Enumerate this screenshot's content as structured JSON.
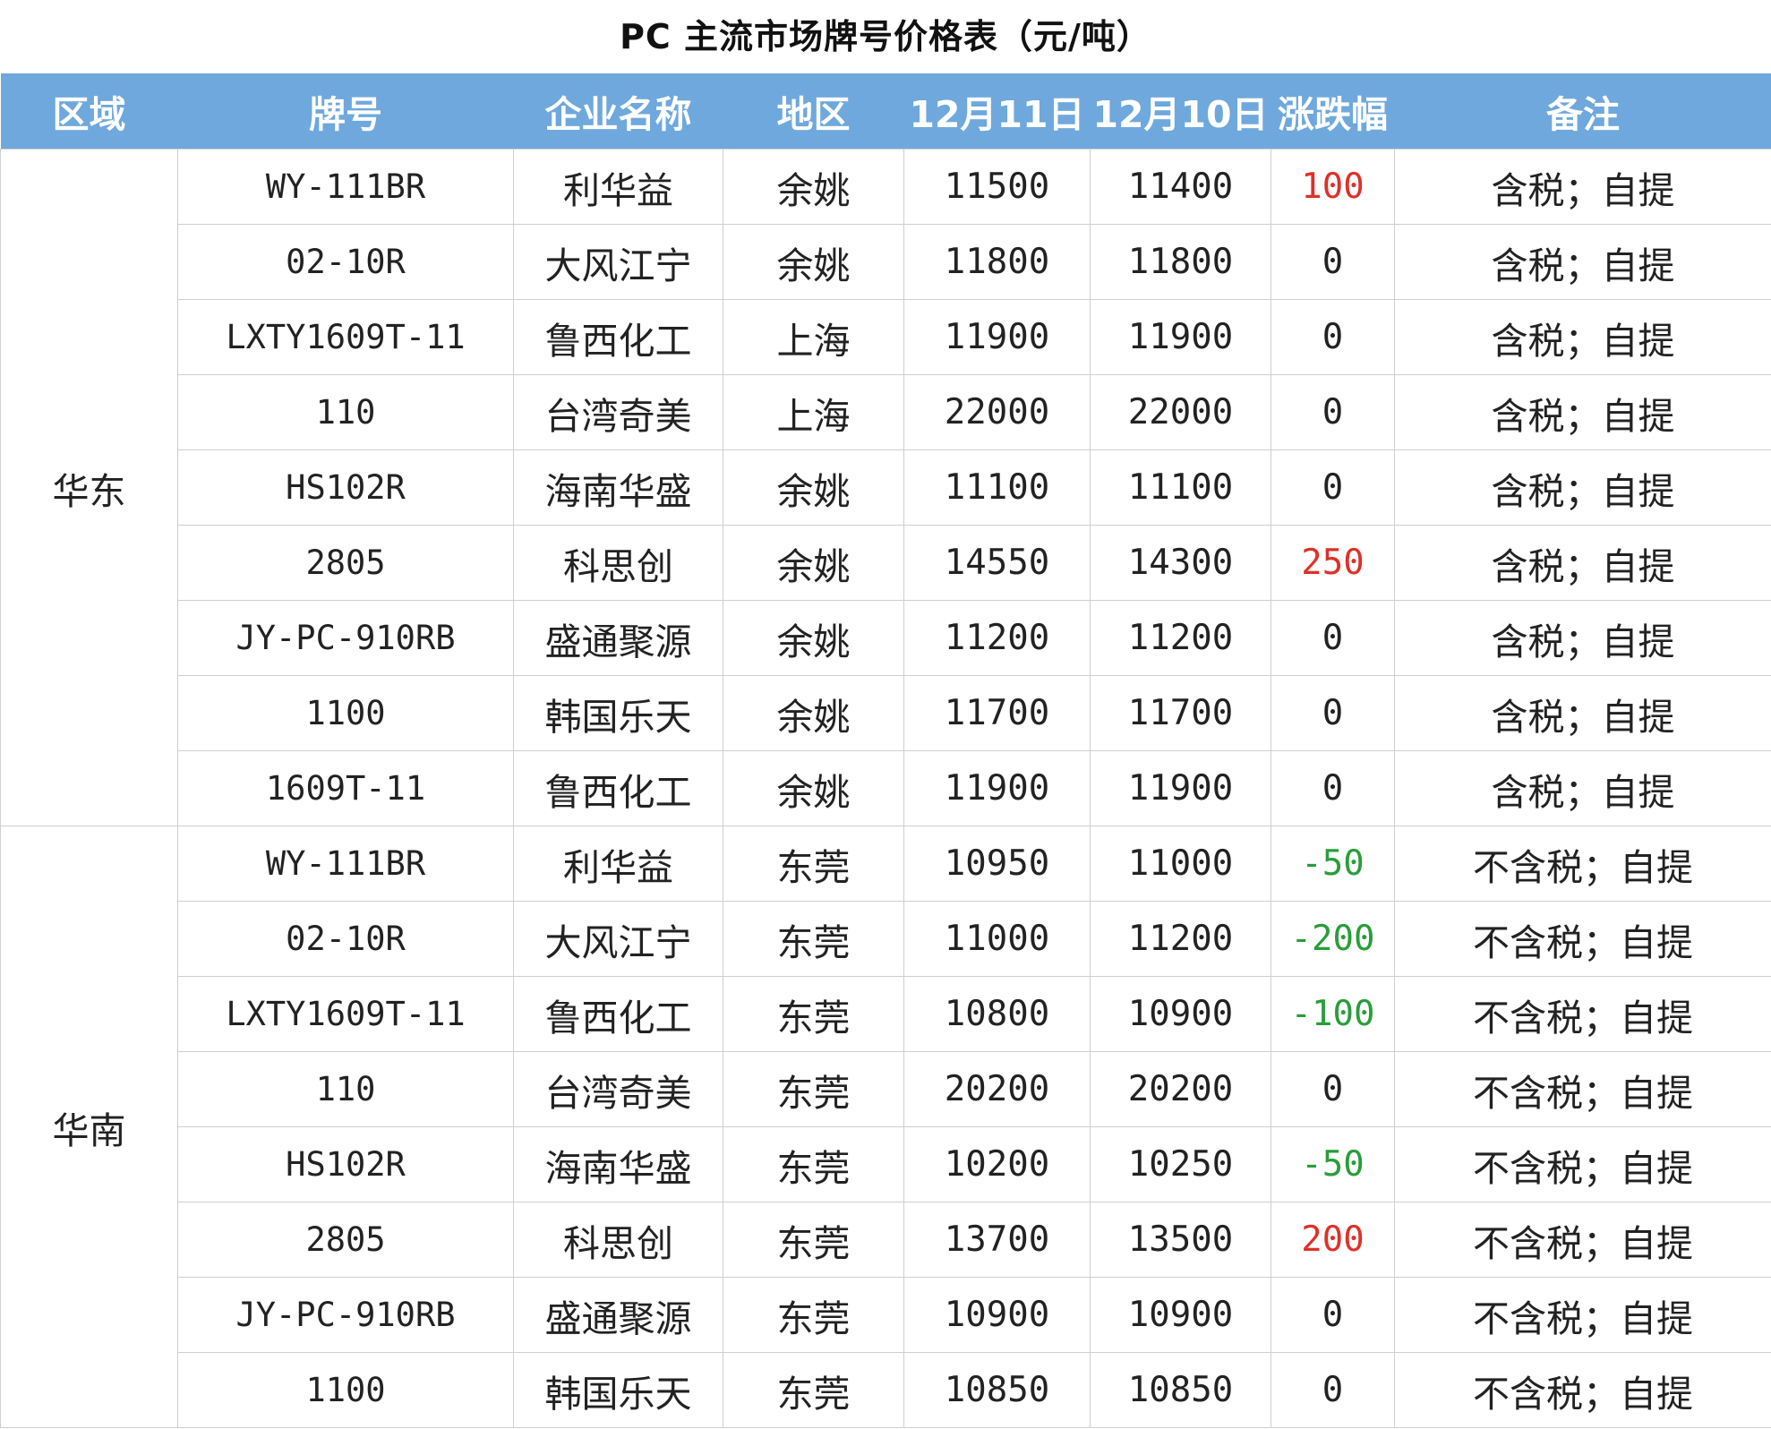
{
  "title": "PC 主流市场牌号价格表（元/吨）",
  "colors": {
    "header_bg": "#6fa8dc",
    "up": "#de3129",
    "down": "#2a9d3a"
  },
  "table": {
    "headers": [
      "区域",
      "牌号",
      "企业名称",
      "地区",
      "12月11日",
      "12月10日",
      "涨跌幅",
      "备注"
    ],
    "regions": [
      {
        "name": "华东",
        "rows": [
          {
            "brand": "WY-111BR",
            "company": "利华益",
            "area": "余姚",
            "price_1211": "11500",
            "price_1210": "11400",
            "change": "100",
            "note": "含税；自提"
          },
          {
            "brand": "02-10R",
            "company": "大风江宁",
            "area": "余姚",
            "price_1211": "11800",
            "price_1210": "11800",
            "change": "0",
            "note": "含税；自提"
          },
          {
            "brand": "LXTY1609T-11",
            "company": "鲁西化工",
            "area": "上海",
            "price_1211": "11900",
            "price_1210": "11900",
            "change": "0",
            "note": "含税；自提"
          },
          {
            "brand": "110",
            "company": "台湾奇美",
            "area": "上海",
            "price_1211": "22000",
            "price_1210": "22000",
            "change": "0",
            "note": "含税；自提"
          },
          {
            "brand": "HS102R",
            "company": "海南华盛",
            "area": "余姚",
            "price_1211": "11100",
            "price_1210": "11100",
            "change": "0",
            "note": "含税；自提"
          },
          {
            "brand": "2805",
            "company": "科思创",
            "area": "余姚",
            "price_1211": "14550",
            "price_1210": "14300",
            "change": "250",
            "note": "含税；自提"
          },
          {
            "brand": "JY-PC-910RB",
            "company": "盛通聚源",
            "area": "余姚",
            "price_1211": "11200",
            "price_1210": "11200",
            "change": "0",
            "note": "含税；自提"
          },
          {
            "brand": "1100",
            "company": "韩国乐天",
            "area": "余姚",
            "price_1211": "11700",
            "price_1210": "11700",
            "change": "0",
            "note": "含税；自提"
          },
          {
            "brand": "1609T-11",
            "company": "鲁西化工",
            "area": "余姚",
            "price_1211": "11900",
            "price_1210": "11900",
            "change": "0",
            "note": "含税；自提"
          }
        ]
      },
      {
        "name": "华南",
        "rows": [
          {
            "brand": "WY-111BR",
            "company": "利华益",
            "area": "东莞",
            "price_1211": "10950",
            "price_1210": "11000",
            "change": "-50",
            "note": "不含税；自提"
          },
          {
            "brand": "02-10R",
            "company": "大风江宁",
            "area": "东莞",
            "price_1211": "11000",
            "price_1210": "11200",
            "change": "-200",
            "note": "不含税；自提"
          },
          {
            "brand": "LXTY1609T-11",
            "company": "鲁西化工",
            "area": "东莞",
            "price_1211": "10800",
            "price_1210": "10900",
            "change": "-100",
            "note": "不含税；自提"
          },
          {
            "brand": "110",
            "company": "台湾奇美",
            "area": "东莞",
            "price_1211": "20200",
            "price_1210": "20200",
            "change": "0",
            "note": "不含税；自提"
          },
          {
            "brand": "HS102R",
            "company": "海南华盛",
            "area": "东莞",
            "price_1211": "10200",
            "price_1210": "10250",
            "change": "-50",
            "note": "不含税；自提"
          },
          {
            "brand": "2805",
            "company": "科思创",
            "area": "东莞",
            "price_1211": "13700",
            "price_1210": "13500",
            "change": "200",
            "note": "不含税；自提"
          },
          {
            "brand": "JY-PC-910RB",
            "company": "盛通聚源",
            "area": "东莞",
            "price_1211": "10900",
            "price_1210": "10900",
            "change": "0",
            "note": "不含税；自提"
          },
          {
            "brand": "1100",
            "company": "韩国乐天",
            "area": "东莞",
            "price_1211": "10850",
            "price_1210": "10850",
            "change": "0",
            "note": "不含税；自提"
          }
        ]
      }
    ]
  }
}
